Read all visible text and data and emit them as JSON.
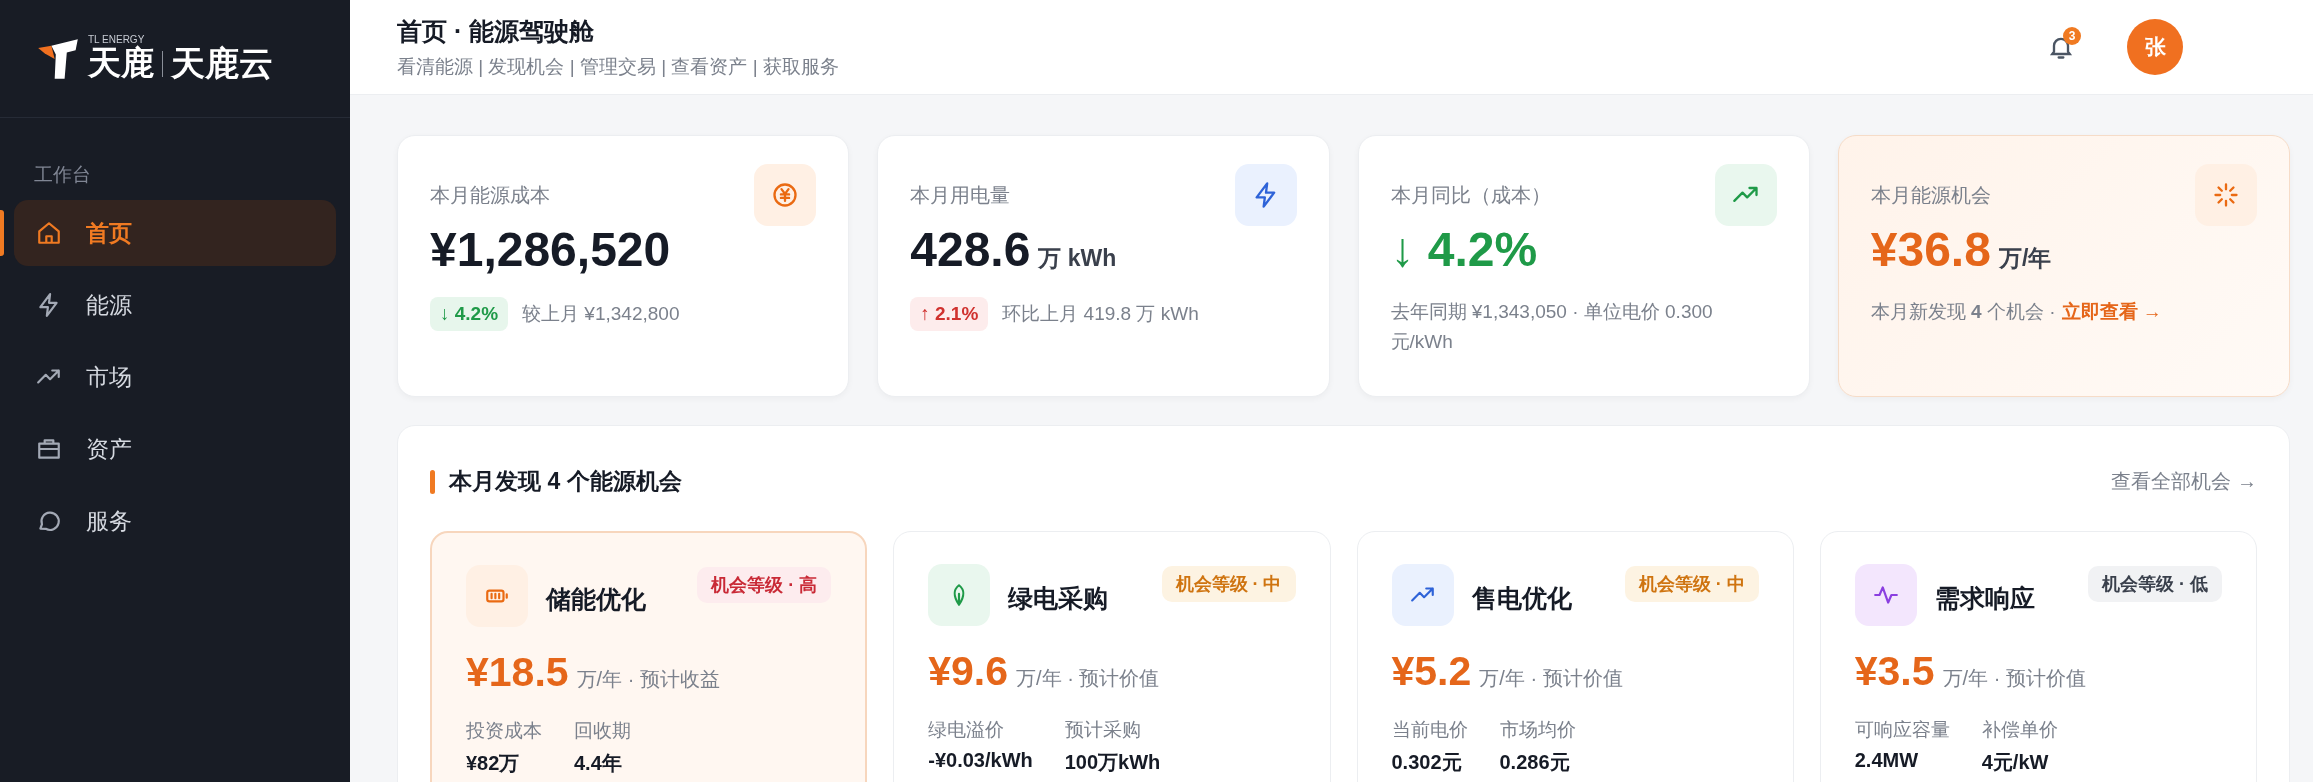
{
  "brand": {
    "tag": "TL ENERGY",
    "name": "天鹿",
    "product": "天鹿云"
  },
  "sidebar": {
    "section": "工作台",
    "items": [
      {
        "label": "首页",
        "kind": "home",
        "selected": true
      },
      {
        "label": "能源",
        "kind": "bolt",
        "selected": false
      },
      {
        "label": "市场",
        "kind": "trend",
        "selected": false
      },
      {
        "label": "资产",
        "kind": "briefcase",
        "selected": false
      },
      {
        "label": "服务",
        "kind": "chat",
        "selected": false
      }
    ]
  },
  "header": {
    "title": "首页 · 能源驾驶舱",
    "subtitle": "看清能源 | 发现机会 | 管理交易 | 查看资产 | 获取服务",
    "notifications": "3",
    "avatar": "张"
  },
  "kpis": [
    {
      "kind": "cost",
      "label": "本月能源成本",
      "value": "¥1,286,520",
      "delta": {
        "text": "↓ 4.2%",
        "kind": "down"
      },
      "note": "较上月 ¥1,342,800",
      "featured": false
    },
    {
      "kind": "usage",
      "label": "本月用电量",
      "value": "428.6",
      "unit": "万 kWh",
      "delta": {
        "text": "↑ 2.1%",
        "kind": "up"
      },
      "note": "环比上月 419.8 万 kWh",
      "featured": false
    },
    {
      "kind": "yoy",
      "label": "本月同比（成本）",
      "value": "↓ 4.2%",
      "note": "去年同期 ¥1,343,050 · 单位电价 0.300 元/kWh",
      "featured": false
    },
    {
      "kind": "opportunity",
      "label": "本月能源机会",
      "value": "¥36.8",
      "unit": "万/年",
      "featured": true,
      "note": "本月新发现 **4** 个机会 ·",
      "link": "立即查看 →"
    }
  ],
  "opportunities": {
    "title": "本月发现 4 个能源机会",
    "link": "查看全部机会 →",
    "items": [
      {
        "kind": "storage",
        "title": "储能优化",
        "grade": {
          "text": "机会等级 · 高",
          "kind": "high"
        },
        "amount": "¥18.5",
        "amount_note": "万/年 · 预计收益",
        "featured": true,
        "metrics": [
          {
            "label": "投资成本",
            "value": "¥82万"
          },
          {
            "label": "回收期",
            "value": "4.4年"
          }
        ]
      },
      {
        "kind": "green",
        "title": "绿电采购",
        "grade": {
          "text": "机会等级 · 中",
          "kind": "medium"
        },
        "amount": "¥9.6",
        "amount_note": "万/年 · 预计价值",
        "featured": false,
        "metrics": [
          {
            "label": "绿电溢价",
            "value": "-¥0.03/kWh"
          },
          {
            "label": "预计采购",
            "value": "100万kWh"
          }
        ]
      },
      {
        "kind": "retail",
        "title": "售电优化",
        "grade": {
          "text": "机会等级 · 中",
          "kind": "medium"
        },
        "amount": "¥5.2",
        "amount_note": "万/年 · 预计价值",
        "featured": false,
        "metrics": [
          {
            "label": "当前电价",
            "value": "0.302元"
          },
          {
            "label": "市场均价",
            "value": "0.286元"
          }
        ]
      },
      {
        "kind": "demand",
        "title": "需求响应",
        "grade": {
          "text": "机会等级 · 低",
          "kind": "low"
        },
        "amount": "¥3.5",
        "amount_note": "万/年 · 预计价值",
        "featured": false,
        "metrics": [
          {
            "label": "可响应容量",
            "value": "2.4MW"
          },
          {
            "label": "补偿单价",
            "value": "4元/kW"
          }
        ]
      }
    ]
  }
}
